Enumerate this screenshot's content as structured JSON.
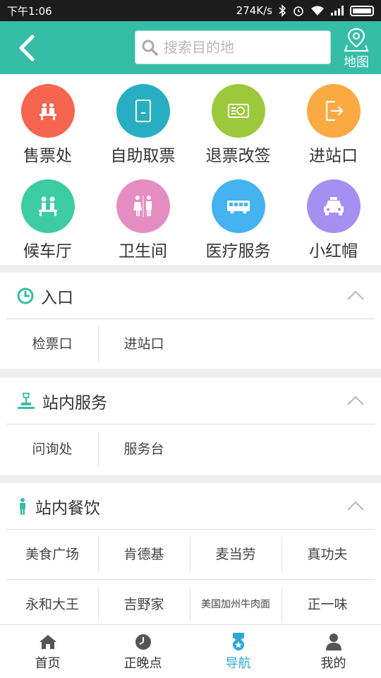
{
  "status_bar": {
    "time": "下午1:06",
    "speed": "274K/s"
  },
  "header": {
    "search_placeholder": "搜索目的地",
    "map_label": "地图",
    "accent": "#36bda8"
  },
  "services": [
    {
      "label": "售票处",
      "icon": "ticket-counter-icon",
      "color": "#f6654f"
    },
    {
      "label": "自助取票",
      "icon": "self-service-kiosk-icon",
      "color": "#27aec3"
    },
    {
      "label": "退票改签",
      "icon": "refund-ticket-icon",
      "color": "#9cc93b"
    },
    {
      "label": "进站口",
      "icon": "station-entrance-icon",
      "color": "#fba942"
    },
    {
      "label": "候车厅",
      "icon": "waiting-hall-icon",
      "color": "#3ccca3"
    },
    {
      "label": "卫生间",
      "icon": "restroom-icon",
      "color": "#e58dc3"
    },
    {
      "label": "医疗服务",
      "icon": "medical-bus-icon",
      "color": "#44b3ef"
    },
    {
      "label": "小红帽",
      "icon": "taxi-icon",
      "color": "#a58ff0"
    }
  ],
  "sections": [
    {
      "title": "入口",
      "icon": "clock-icon",
      "rows": [
        [
          "检票口",
          "进站口"
        ]
      ]
    },
    {
      "title": "站内服务",
      "icon": "service-desk-icon",
      "rows": [
        [
          "问询处",
          "服务台"
        ]
      ]
    },
    {
      "title": "站内餐饮",
      "icon": "person-icon",
      "rows": [
        [
          "美食广场",
          "肯德基",
          "麦当劳",
          "真功夫"
        ],
        [
          "永和大王",
          "吉野家",
          "美国加州牛肉面",
          "正一味"
        ]
      ]
    }
  ],
  "tabs": [
    {
      "label": "首页",
      "icon": "home-icon"
    },
    {
      "label": "正晚点",
      "icon": "clock-icon"
    },
    {
      "label": "导航",
      "icon": "badge-icon",
      "active": true
    },
    {
      "label": "我的",
      "icon": "user-icon"
    }
  ],
  "active_color": "#2aa9d8"
}
